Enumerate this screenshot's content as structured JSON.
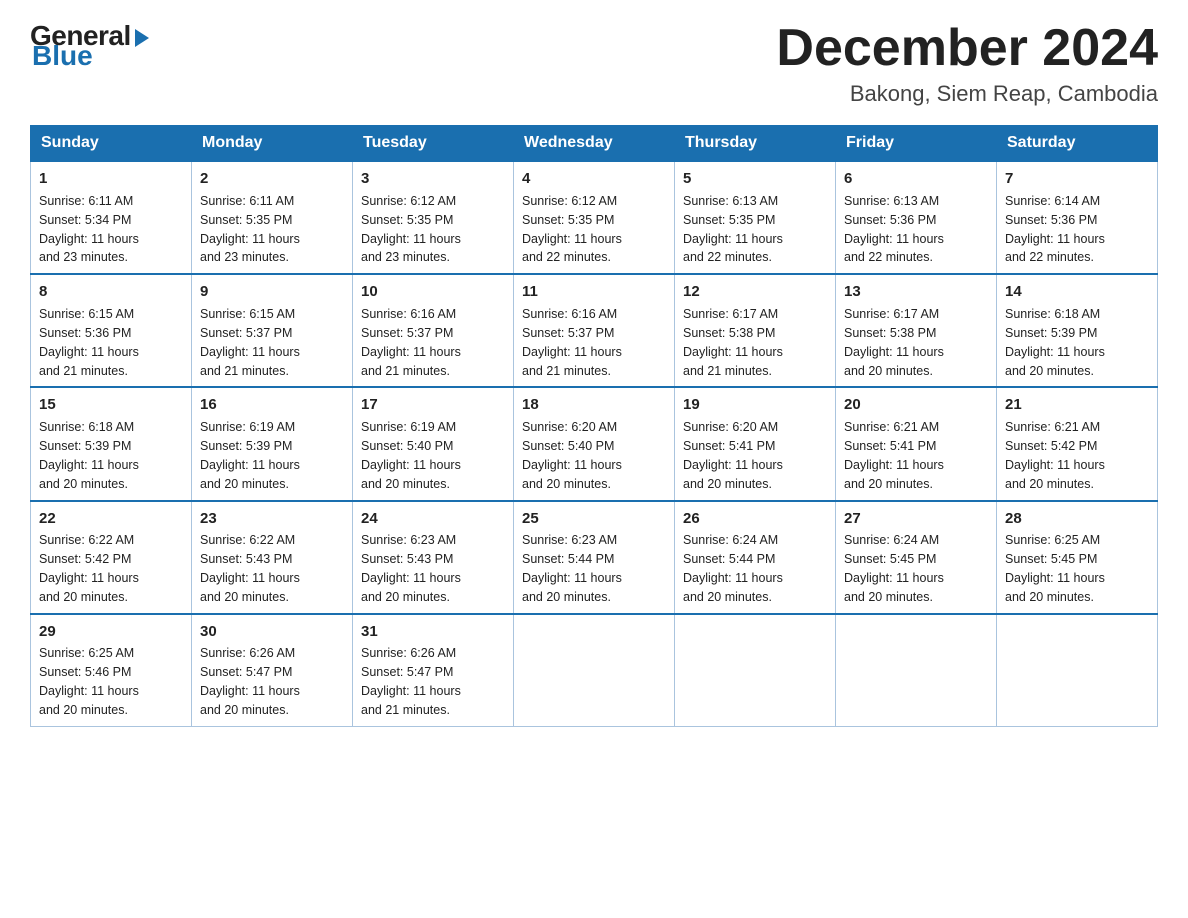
{
  "logo": {
    "general": "General",
    "blue": "Blue"
  },
  "title": "December 2024",
  "location": "Bakong, Siem Reap, Cambodia",
  "weekdays": [
    "Sunday",
    "Monday",
    "Tuesday",
    "Wednesday",
    "Thursday",
    "Friday",
    "Saturday"
  ],
  "weeks": [
    [
      {
        "day": "1",
        "sunrise": "6:11 AM",
        "sunset": "5:34 PM",
        "daylight": "11 hours and 23 minutes."
      },
      {
        "day": "2",
        "sunrise": "6:11 AM",
        "sunset": "5:35 PM",
        "daylight": "11 hours and 23 minutes."
      },
      {
        "day": "3",
        "sunrise": "6:12 AM",
        "sunset": "5:35 PM",
        "daylight": "11 hours and 23 minutes."
      },
      {
        "day": "4",
        "sunrise": "6:12 AM",
        "sunset": "5:35 PM",
        "daylight": "11 hours and 22 minutes."
      },
      {
        "day": "5",
        "sunrise": "6:13 AM",
        "sunset": "5:35 PM",
        "daylight": "11 hours and 22 minutes."
      },
      {
        "day": "6",
        "sunrise": "6:13 AM",
        "sunset": "5:36 PM",
        "daylight": "11 hours and 22 minutes."
      },
      {
        "day": "7",
        "sunrise": "6:14 AM",
        "sunset": "5:36 PM",
        "daylight": "11 hours and 22 minutes."
      }
    ],
    [
      {
        "day": "8",
        "sunrise": "6:15 AM",
        "sunset": "5:36 PM",
        "daylight": "11 hours and 21 minutes."
      },
      {
        "day": "9",
        "sunrise": "6:15 AM",
        "sunset": "5:37 PM",
        "daylight": "11 hours and 21 minutes."
      },
      {
        "day": "10",
        "sunrise": "6:16 AM",
        "sunset": "5:37 PM",
        "daylight": "11 hours and 21 minutes."
      },
      {
        "day": "11",
        "sunrise": "6:16 AM",
        "sunset": "5:37 PM",
        "daylight": "11 hours and 21 minutes."
      },
      {
        "day": "12",
        "sunrise": "6:17 AM",
        "sunset": "5:38 PM",
        "daylight": "11 hours and 21 minutes."
      },
      {
        "day": "13",
        "sunrise": "6:17 AM",
        "sunset": "5:38 PM",
        "daylight": "11 hours and 20 minutes."
      },
      {
        "day": "14",
        "sunrise": "6:18 AM",
        "sunset": "5:39 PM",
        "daylight": "11 hours and 20 minutes."
      }
    ],
    [
      {
        "day": "15",
        "sunrise": "6:18 AM",
        "sunset": "5:39 PM",
        "daylight": "11 hours and 20 minutes."
      },
      {
        "day": "16",
        "sunrise": "6:19 AM",
        "sunset": "5:39 PM",
        "daylight": "11 hours and 20 minutes."
      },
      {
        "day": "17",
        "sunrise": "6:19 AM",
        "sunset": "5:40 PM",
        "daylight": "11 hours and 20 minutes."
      },
      {
        "day": "18",
        "sunrise": "6:20 AM",
        "sunset": "5:40 PM",
        "daylight": "11 hours and 20 minutes."
      },
      {
        "day": "19",
        "sunrise": "6:20 AM",
        "sunset": "5:41 PM",
        "daylight": "11 hours and 20 minutes."
      },
      {
        "day": "20",
        "sunrise": "6:21 AM",
        "sunset": "5:41 PM",
        "daylight": "11 hours and 20 minutes."
      },
      {
        "day": "21",
        "sunrise": "6:21 AM",
        "sunset": "5:42 PM",
        "daylight": "11 hours and 20 minutes."
      }
    ],
    [
      {
        "day": "22",
        "sunrise": "6:22 AM",
        "sunset": "5:42 PM",
        "daylight": "11 hours and 20 minutes."
      },
      {
        "day": "23",
        "sunrise": "6:22 AM",
        "sunset": "5:43 PM",
        "daylight": "11 hours and 20 minutes."
      },
      {
        "day": "24",
        "sunrise": "6:23 AM",
        "sunset": "5:43 PM",
        "daylight": "11 hours and 20 minutes."
      },
      {
        "day": "25",
        "sunrise": "6:23 AM",
        "sunset": "5:44 PM",
        "daylight": "11 hours and 20 minutes."
      },
      {
        "day": "26",
        "sunrise": "6:24 AM",
        "sunset": "5:44 PM",
        "daylight": "11 hours and 20 minutes."
      },
      {
        "day": "27",
        "sunrise": "6:24 AM",
        "sunset": "5:45 PM",
        "daylight": "11 hours and 20 minutes."
      },
      {
        "day": "28",
        "sunrise": "6:25 AM",
        "sunset": "5:45 PM",
        "daylight": "11 hours and 20 minutes."
      }
    ],
    [
      {
        "day": "29",
        "sunrise": "6:25 AM",
        "sunset": "5:46 PM",
        "daylight": "11 hours and 20 minutes."
      },
      {
        "day": "30",
        "sunrise": "6:26 AM",
        "sunset": "5:47 PM",
        "daylight": "11 hours and 20 minutes."
      },
      {
        "day": "31",
        "sunrise": "6:26 AM",
        "sunset": "5:47 PM",
        "daylight": "11 hours and 21 minutes."
      },
      null,
      null,
      null,
      null
    ]
  ],
  "labels": {
    "sunrise": "Sunrise:",
    "sunset": "Sunset:",
    "daylight": "Daylight:"
  }
}
